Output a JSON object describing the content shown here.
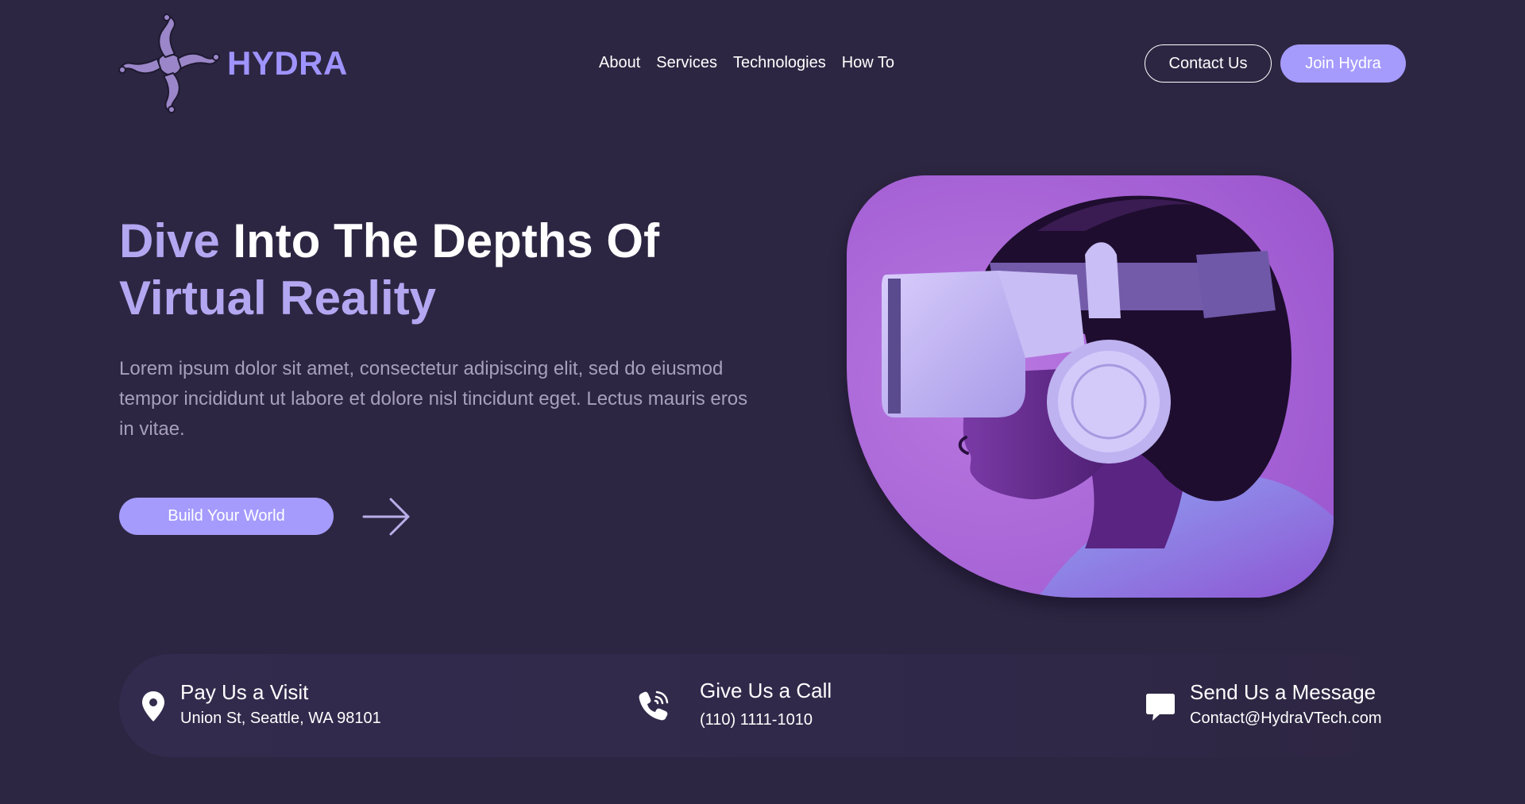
{
  "brand": {
    "name": "HYDRA",
    "color": "#9f93ff"
  },
  "nav": {
    "items": [
      {
        "label": "About"
      },
      {
        "label": "Services"
      },
      {
        "label": "Technologies"
      },
      {
        "label": "How To"
      }
    ]
  },
  "header_actions": {
    "contact_label": "Contact Us",
    "join_label": "Join Hydra"
  },
  "hero": {
    "title_accent": "Dive",
    "title_rest": " Into The Depths Of ",
    "title_line2": "Virtual Reality",
    "description": "Lorem ipsum dolor sit amet, consectetur adipiscing elit, sed do eiusmod tempor incididunt ut labore et dolore nisl tincidunt eget. Lectus mauris eros in vitae.",
    "cta_label": "Build Your World",
    "arrow_icon": "arrow-right-icon"
  },
  "contact": {
    "visit": {
      "icon": "map-pin-icon",
      "title": "Pay Us a Visit",
      "detail": "Union St, Seattle, WA 98101"
    },
    "call": {
      "icon": "phone-icon",
      "title": "Give Us a Call",
      "detail": "(110) 1111-1010"
    },
    "message": {
      "icon": "chat-bubble-icon",
      "title": "Send Us a Message",
      "detail": "Contact@HydraVTech.com"
    }
  },
  "colors": {
    "background": "#2d2642",
    "accent": "#a59bfd",
    "accent_text": "#b3a7f1",
    "muted_text": "#a79fbd",
    "image_bg": "#a45fd2"
  }
}
